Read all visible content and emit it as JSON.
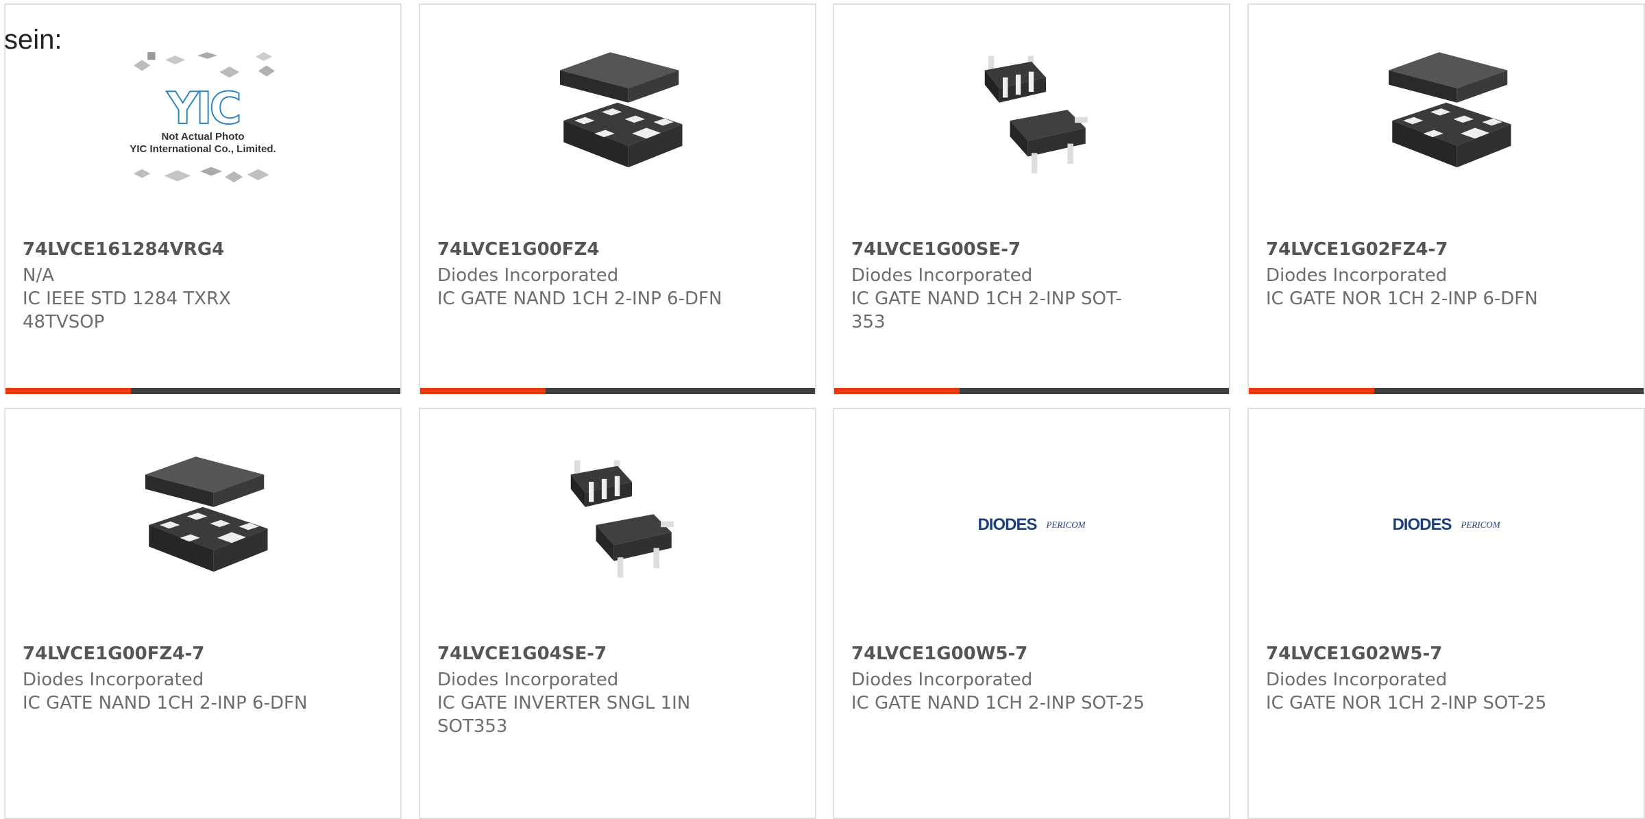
{
  "lead_text": "sein:",
  "placeholder": {
    "logo": "YIC",
    "note_line1": "Not Actual Photo",
    "note_line2": "YIC International Co., Limited."
  },
  "brand_logo": {
    "name": "DIODES",
    "partner": "PERICOM"
  },
  "colors": {
    "accent_bar": "#e8380d",
    "bar_dark": "#404040",
    "card_border": "#e0e0e0",
    "part_number": "#555555",
    "text": "#6d6d6d"
  },
  "products": [
    {
      "part_number": "74LVCE161284VRG4",
      "manufacturer": "N/A",
      "description": "IC IEEE STD 1284 TXRX 48TVSOP",
      "image": "placeholder-photo"
    },
    {
      "part_number": "74LVCE1G00FZ4",
      "manufacturer": "Diodes Incorporated",
      "description": "IC GATE NAND 1CH 2-INP 6-DFN",
      "image": "dfn-package-icon"
    },
    {
      "part_number": "74LVCE1G00SE-7",
      "manufacturer": "Diodes Incorporated",
      "description": "IC GATE NAND 1CH 2-INP SOT-353",
      "image": "sot353-package-icon"
    },
    {
      "part_number": "74LVCE1G02FZ4-7",
      "manufacturer": "Diodes Incorporated",
      "description": "IC GATE NOR 1CH 2-INP 6-DFN",
      "image": "dfn-package-icon"
    },
    {
      "part_number": "74LVCE1G00FZ4-7",
      "manufacturer": "Diodes Incorporated",
      "description": "IC GATE NAND 1CH 2-INP 6-DFN",
      "image": "dfn-package-icon"
    },
    {
      "part_number": "74LVCE1G04SE-7",
      "manufacturer": "Diodes Incorporated",
      "description": "IC GATE INVERTER SNGL 1IN SOT353",
      "image": "sot353-package-icon"
    },
    {
      "part_number": "74LVCE1G00W5-7",
      "manufacturer": "Diodes Incorporated",
      "description": "IC GATE NAND 1CH 2-INP SOT-25",
      "image": "diodes-logo"
    },
    {
      "part_number": "74LVCE1G02W5-7",
      "manufacturer": "Diodes Incorporated",
      "description": "IC GATE NOR 1CH 2-INP SOT-25",
      "image": "diodes-logo"
    }
  ]
}
